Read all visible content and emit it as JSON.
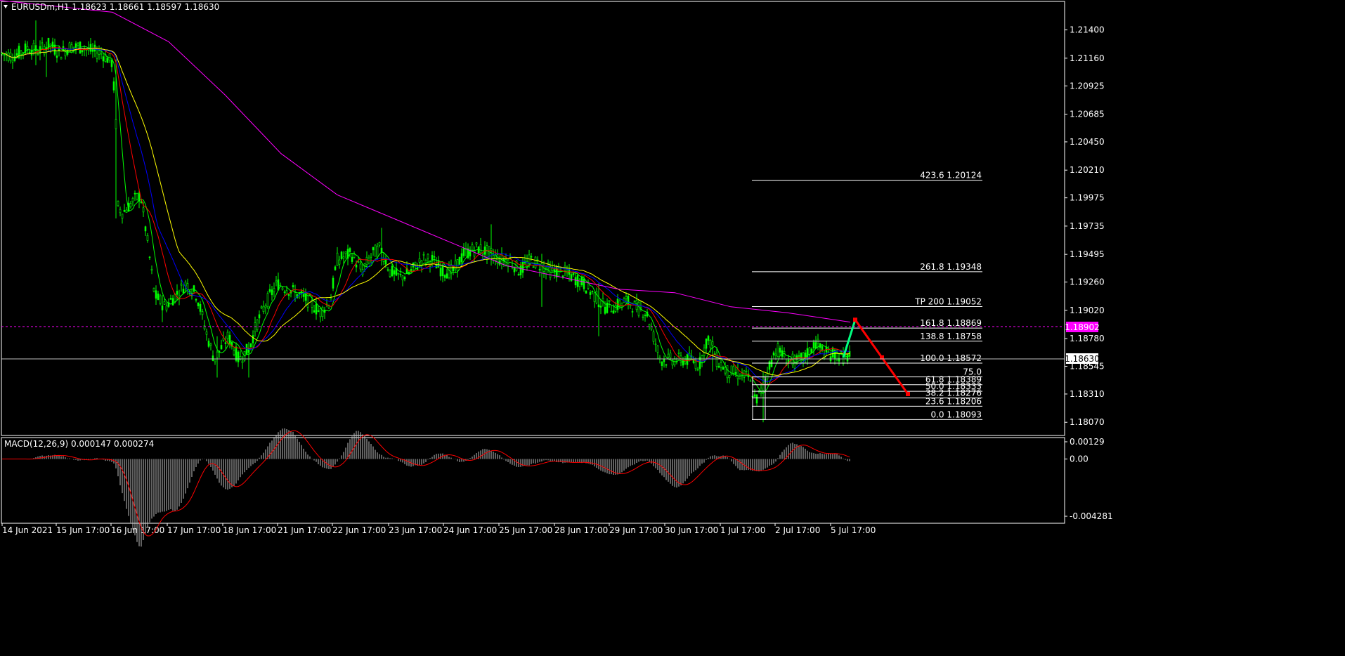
{
  "header": {
    "symbol_line": "EURUSDm,H1  1.18623 1.18661 1.18597 1.18630"
  },
  "macd_label": "MACD(12,26,9) 0.000147 0.000274",
  "colors": {
    "background": "#000000",
    "frame": "#ffffff",
    "bull": "#00ff00",
    "ma_fast": "#00ff00",
    "ma_mid": "#ff0000",
    "ma_slow": "#0000ff",
    "ma_yellow": "#ffff00",
    "ma_long": "#ff00ff",
    "fib": "#ffffff",
    "price_line": "#c0c0c0",
    "alert": "#ff00ff",
    "forecast_up": "#00ff80",
    "forecast_down": "#ff0000",
    "macd_hist": "#c0c0c0",
    "macd_signal": "#ff0000"
  },
  "chart_data": {
    "type": "candlestick",
    "price_axis": {
      "ylim": [
        1.1797,
        1.2163
      ],
      "ticks": [
        "1.21400",
        "1.21160",
        "1.20925",
        "1.20685",
        "1.20450",
        "1.20210",
        "1.19975",
        "1.19735",
        "1.19495",
        "1.19260",
        "1.19020",
        "1.18780",
        "1.18545",
        "1.18310",
        "1.18070"
      ]
    },
    "current_price": "1.18630",
    "alert_price": "1.18902",
    "time_labels": [
      "14 Jun 2021",
      "15 Jun 17:00",
      "16 Jun 17:00",
      "17 Jun 17:00",
      "18 Jun 17:00",
      "21 Jun 17:00",
      "22 Jun 17:00",
      "23 Jun 17:00",
      "24 Jun 17:00",
      "25 Jun 17:00",
      "28 Jun 17:00",
      "29 Jun 17:00",
      "30 Jun 17:00",
      "1 Jul 17:00",
      "2 Jul 17:00",
      "5 Jul 17:00"
    ],
    "price_path": [
      [
        0,
        1.212
      ],
      [
        20,
        1.2118
      ],
      [
        40,
        1.2125
      ],
      [
        55,
        1.2122
      ],
      [
        70,
        1.2128
      ],
      [
        85,
        1.212
      ],
      [
        100,
        1.2126
      ],
      [
        118,
        1.2125
      ],
      [
        130,
        1.2122
      ],
      [
        145,
        1.212
      ],
      [
        160,
        1.2112
      ],
      [
        165,
        1.206
      ],
      [
        168,
        1.199
      ],
      [
        175,
        1.1985
      ],
      [
        190,
        1.1995
      ],
      [
        200,
        1.2
      ],
      [
        210,
        1.196
      ],
      [
        220,
        1.1915
      ],
      [
        235,
        1.1905
      ],
      [
        250,
        1.1915
      ],
      [
        265,
        1.1925
      ],
      [
        280,
        1.1915
      ],
      [
        295,
        1.188
      ],
      [
        305,
        1.186
      ],
      [
        315,
        1.187
      ],
      [
        325,
        1.188
      ],
      [
        340,
        1.186
      ],
      [
        355,
        1.187
      ],
      [
        365,
        1.189
      ],
      [
        380,
        1.191
      ],
      [
        395,
        1.1925
      ],
      [
        410,
        1.192
      ],
      [
        425,
        1.1915
      ],
      [
        440,
        1.191
      ],
      [
        455,
        1.19
      ],
      [
        470,
        1.191
      ],
      [
        480,
        1.1945
      ],
      [
        500,
        1.195
      ],
      [
        515,
        1.1935
      ],
      [
        530,
        1.195
      ],
      [
        542,
        1.1955
      ],
      [
        555,
        1.1935
      ],
      [
        570,
        1.193
      ],
      [
        585,
        1.1935
      ],
      [
        600,
        1.1945
      ],
      [
        615,
        1.1945
      ],
      [
        630,
        1.1935
      ],
      [
        645,
        1.1935
      ],
      [
        660,
        1.195
      ],
      [
        680,
        1.1955
      ],
      [
        698,
        1.195
      ],
      [
        712,
        1.1945
      ],
      [
        725,
        1.1945
      ],
      [
        740,
        1.1935
      ],
      [
        755,
        1.1945
      ],
      [
        770,
        1.194
      ],
      [
        785,
        1.1935
      ],
      [
        800,
        1.1935
      ],
      [
        815,
        1.193
      ],
      [
        830,
        1.1925
      ],
      [
        845,
        1.1915
      ],
      [
        860,
        1.1905
      ],
      [
        875,
        1.1905
      ],
      [
        890,
        1.191
      ],
      [
        905,
        1.1905
      ],
      [
        920,
        1.19
      ],
      [
        930,
        1.188
      ],
      [
        940,
        1.186
      ],
      [
        955,
        1.186
      ],
      [
        970,
        1.186
      ],
      [
        985,
        1.186
      ],
      [
        995,
        1.1855
      ],
      [
        1005,
        1.1875
      ],
      [
        1012,
        1.1875
      ],
      [
        1020,
        1.186
      ],
      [
        1035,
        1.185
      ],
      [
        1050,
        1.1848
      ],
      [
        1065,
        1.1845
      ],
      [
        1075,
        1.1825
      ],
      [
        1085,
        1.1835
      ],
      [
        1095,
        1.1855
      ],
      [
        1105,
        1.187
      ],
      [
        1120,
        1.186
      ],
      [
        1135,
        1.1858
      ],
      [
        1150,
        1.1865
      ],
      [
        1160,
        1.1875
      ],
      [
        1175,
        1.1865
      ],
      [
        1190,
        1.1865
      ],
      [
        1200,
        1.1862
      ],
      [
        1210,
        1.1863
      ]
    ],
    "spikes": [
      [
        50,
        1.2148,
        1.211
      ],
      [
        65,
        1.213,
        1.21
      ],
      [
        164,
        1.2115,
        1.198
      ],
      [
        232,
        1.1915,
        1.1892
      ],
      [
        310,
        1.188,
        1.1845
      ],
      [
        353,
        1.1875,
        1.1845
      ],
      [
        542,
        1.1972,
        1.194
      ],
      [
        698,
        1.1975,
        1.194
      ],
      [
        772,
        1.195,
        1.1905
      ],
      [
        852,
        1.1925,
        1.188
      ],
      [
        1013,
        1.188,
        1.185
      ],
      [
        1087,
        1.185,
        1.1807
      ]
    ],
    "ma_long_path": [
      [
        0,
        1.2165
      ],
      [
        80,
        1.216
      ],
      [
        160,
        1.2155
      ],
      [
        240,
        1.213
      ],
      [
        320,
        1.2085
      ],
      [
        400,
        1.2035
      ],
      [
        480,
        1.2
      ],
      [
        560,
        1.198
      ],
      [
        640,
        1.196
      ],
      [
        720,
        1.194
      ],
      [
        800,
        1.193
      ],
      [
        880,
        1.192
      ],
      [
        960,
        1.1917
      ],
      [
        1040,
        1.1905
      ],
      [
        1120,
        1.19
      ],
      [
        1210,
        1.1892
      ]
    ],
    "fib_levels": [
      {
        "label": "423.6 1.20124",
        "price": 1.20124
      },
      {
        "label": "261.8 1.19348",
        "price": 1.19348
      },
      {
        "label": "TP 200 1.19052",
        "price": 1.19052
      },
      {
        "label": "161.8 1.18869",
        "price": 1.18869
      },
      {
        "label": "138.8 1.18758",
        "price": 1.18758
      },
      {
        "label": "100.0 1.18572",
        "price": 1.18572
      },
      {
        "label": "75.0",
        "price": 1.18455
      },
      {
        "label": "61.8 1.18389",
        "price": 1.18389
      },
      {
        "label": "50.0 1.18333",
        "price": 1.18333
      },
      {
        "label": "38.2 1.18276",
        "price": 1.18276
      },
      {
        "label": "23.6 1.18206",
        "price": 1.18206
      },
      {
        "label": "0.0 1.18093",
        "price": 1.18093
      }
    ],
    "forecast": {
      "up": [
        [
          1200,
          1.1862
        ],
        [
          1217,
          1.1894
        ]
      ],
      "down": [
        [
          1217,
          1.1894
        ],
        [
          1255,
          1.1862
        ],
        [
          1292,
          1.1831
        ]
      ]
    },
    "macd": {
      "ticks": [
        {
          "label": "0.00129",
          "value": 0.00129
        },
        {
          "label": "0.00",
          "value": 0.0
        },
        {
          "label": "-0.004281",
          "value": -0.004281
        }
      ],
      "ylim": [
        -0.0047,
        0.0015
      ]
    }
  }
}
